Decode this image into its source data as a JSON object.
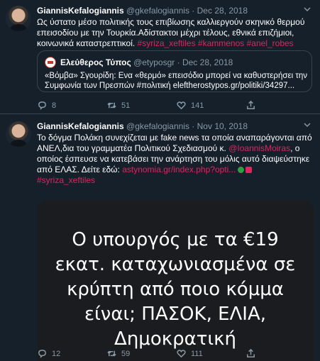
{
  "tweets": [
    {
      "name": "GiannisKefalogiannis",
      "handle": "@gkefalogiannis",
      "separator": "·",
      "date": "Dec 28, 2018",
      "text": "Ως ύστατο μέσο πολιτικής τους επιβίωσης καλλιεργούν σκηνικό θερμού επεισοδίου με την Τουρκία.Αδίστακτοι μέχρι τέλους, εθνικά επιζήμιοι, κοινωνικά καταστρεπτικοί.",
      "hashtags": [
        "#syriza_xeftiles",
        "#kammenos",
        "#anel_robes"
      ],
      "quote": {
        "name": "Ελεύθερος Τύπος",
        "handle": "@etyposgr",
        "separator": "·",
        "date": "Dec 28, 2018",
        "text": "«Βόμβα» Σγουρίδη: Ενα «θερμό» επεισόδιο μπορεί να καθυστερήσει την Συμφωνία των Πρεσπών #πολιτική    eleftherostypos.gr/politiki/34297..."
      },
      "replies": "8",
      "retweets": "51",
      "likes": "141"
    },
    {
      "name": "GiannisKefalogiannis",
      "handle": "@gkefalogiannis",
      "separator": "·",
      "date": "Nov 10, 2018",
      "text_part1": "Το δόγμα Πολάκη συνεχίζεται με fake news τα οποία αναπαράγονται  από ΑΝΕΛ,δια του γραμματέα Πολιτικού Σχεδιασμού κ.",
      "mention": "@IoannisMoiras",
      "text_part2": ", ο οποίος έσπευσε να κατεβάσει την ανάρτηση του μόλις αυτό διαψεύστηκε από ΕΛΑΣ. Δείτε εδώ:",
      "link": "astynomia.gr/index.php?opti...",
      "hashtag": "#syriza_xeftiles",
      "media_text": "Ο υπουργός με τα €19 εκατ. καταχωνιασμένα σε κρύπτη από ποιο κόμμα είναι; ΠΑΣΟΚ, ΕΛΙΑ, Δημοκρατική",
      "replies": "12",
      "retweets": "59",
      "likes": "111"
    }
  ],
  "icons": {
    "more": "chevron-down-icon",
    "reply": "reply-icon",
    "retweet": "retweet-icon",
    "like": "heart-icon",
    "share": "share-icon"
  },
  "colors": {
    "background": "#15202b",
    "secondary_text": "#8899a6",
    "hashtag": "#e0245e",
    "border": "#38444d"
  }
}
